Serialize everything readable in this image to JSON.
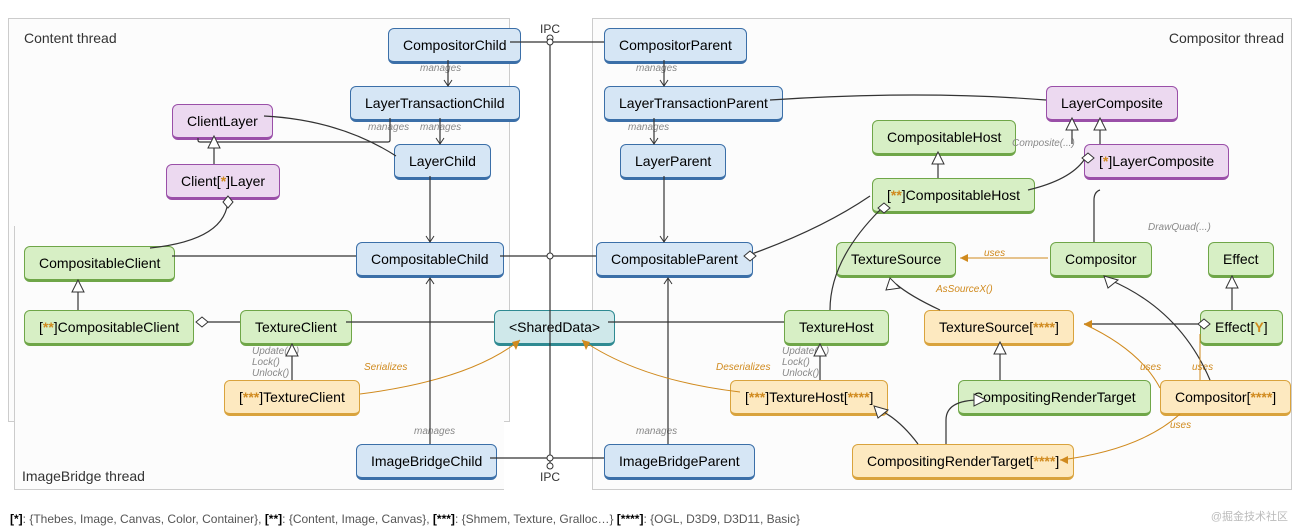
{
  "regions": {
    "content": {
      "label": "Content thread"
    },
    "compositor": {
      "label": "Compositor thread"
    },
    "imagebridge": {
      "label": "ImageBridge thread"
    }
  },
  "ipc": {
    "top": "IPC",
    "bottom": "IPC"
  },
  "nodes": {
    "compositorChild": "CompositorChild",
    "layerTransactionChild": "LayerTransactionChild",
    "layerChild": "LayerChild",
    "clientLayer": "ClientLayer",
    "clientStarLayer_pre": "Client[",
    "clientStarLayer_star": "*",
    "clientStarLayer_post": "]Layer",
    "compositableClient": "CompositableClient",
    "starCompositableClient_pre": "[",
    "starCompositableClient_star": "**",
    "starCompositableClient_post": "]CompositableClient",
    "textureClient": "TextureClient",
    "starTextureClient_pre": "[",
    "starTextureClient_star": "***",
    "starTextureClient_post": "]TextureClient",
    "compositableChild": "CompositableChild",
    "sharedData": "<SharedData>",
    "imageBridgeChild": "ImageBridgeChild",
    "compositorParent": "CompositorParent",
    "layerTransactionParent": "LayerTransactionParent",
    "layerParent": "LayerParent",
    "compositableParent": "CompositableParent",
    "imageBridgeParent": "ImageBridgeParent",
    "textureHost": "TextureHost",
    "starTextureHost_pre": "[",
    "starTextureHost_star": "***",
    "starTextureHost_mid": "]TextureHost[",
    "starTextureHost_star2": "****",
    "starTextureHost_post": "]",
    "compositableHost": "CompositableHost",
    "starCompositableHost_pre": "[",
    "starCompositableHost_star": "**",
    "starCompositableHost_post": "]CompositableHost",
    "layerComposite": "LayerComposite",
    "starLayerComposite_pre": "[",
    "starLayerComposite_star": "*",
    "starLayerComposite_post": "]LayerComposite",
    "textureSource": "TextureSource",
    "textureSourceStar_pre": "TextureSource[",
    "textureSourceStar_star": "****",
    "textureSourceStar_post": "]",
    "compositor": "Compositor",
    "compositorStar_pre": "Compositor[",
    "compositorStar_star": "****",
    "compositorStar_post": "]",
    "effect": "Effect",
    "effectY_pre": "Effect[",
    "effectY_y": "Y",
    "effectY_post": "]",
    "compositingRenderTarget": "CompositingRenderTarget",
    "compositingRenderTargetStar_pre": "CompositingRenderTarget[",
    "compositingRenderTargetStar_star": "****",
    "compositingRenderTargetStar_post": "]"
  },
  "edgeLabels": {
    "manages": "manages",
    "serializes": "Serializes",
    "deserializes": "Deserializes",
    "updateLockUnlock": "Update(...)\nLock()\nUnlock()",
    "composite": "Composite(...)",
    "drawQuad": "DrawQuad(...)",
    "asSourceX": "AsSourceX()",
    "uses": "uses"
  },
  "footer": {
    "k1": "[*]",
    "v1": ": {Thebes, Image, Canvas, Color, Container}, ",
    "k2": "[**]",
    "v2": ": {Content, Image, Canvas}, ",
    "k3": "[***]",
    "v3": ": {Shmem, Texture, Gralloc…} ",
    "k4": "[****]",
    "v4": ": {OGL, D3D9, D3D11, Basic}"
  },
  "watermark": "@掘金技术社区"
}
